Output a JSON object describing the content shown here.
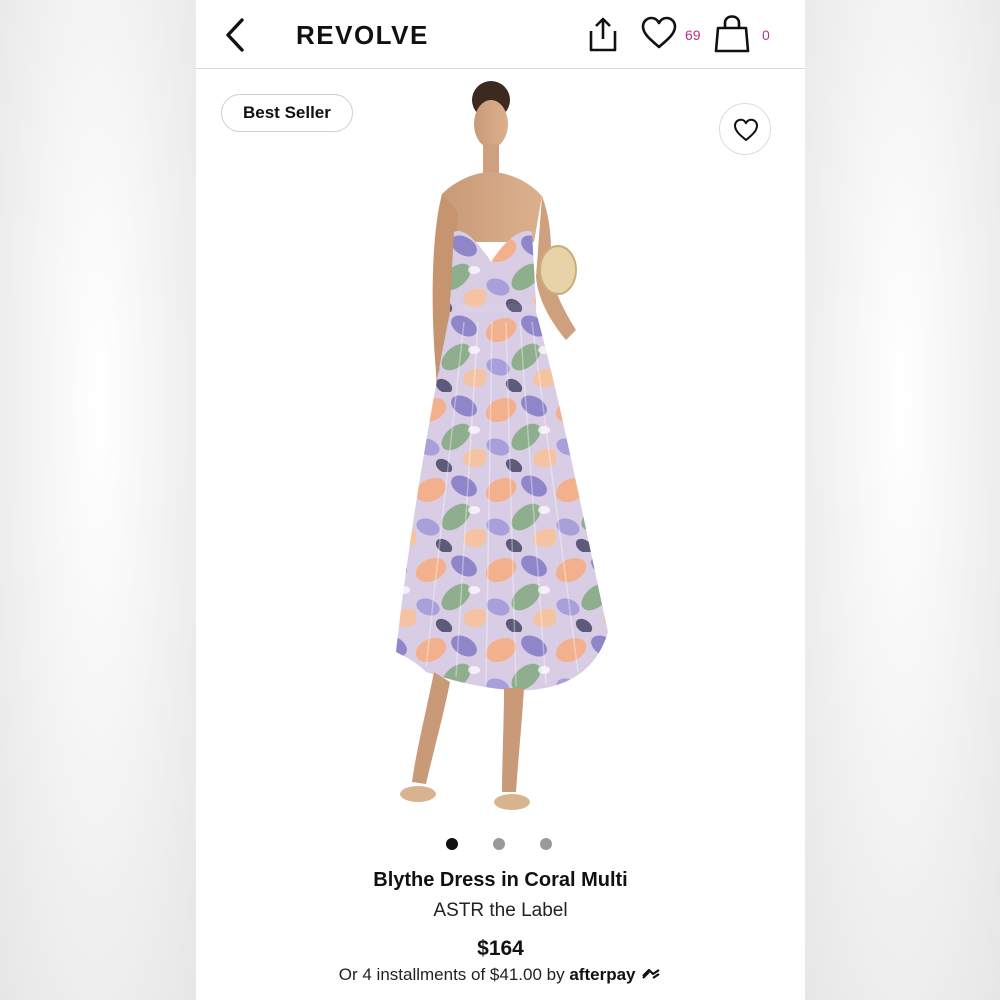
{
  "header": {
    "brand": "REVOLVE",
    "wishlist_count": "69",
    "bag_count": "0",
    "accent_color": "#b5338a"
  },
  "product": {
    "badge": "Best Seller",
    "title": "Blythe Dress in Coral Multi",
    "designer": "ASTR the Label",
    "price": "$164",
    "installments_text": "Or 4 installments of $41.00 by",
    "installments_provider": "afterpay",
    "image_count": 3,
    "active_image": 1,
    "image_subject": "model wearing floral pleated midi dress"
  },
  "icons": {
    "back": "chevron-left-icon",
    "share": "share-icon",
    "wishlist": "heart-icon",
    "bag": "shopping-bag-icon",
    "favorite": "heart-outline-icon",
    "afterpay_logo": "afterpay-loop-icon"
  }
}
